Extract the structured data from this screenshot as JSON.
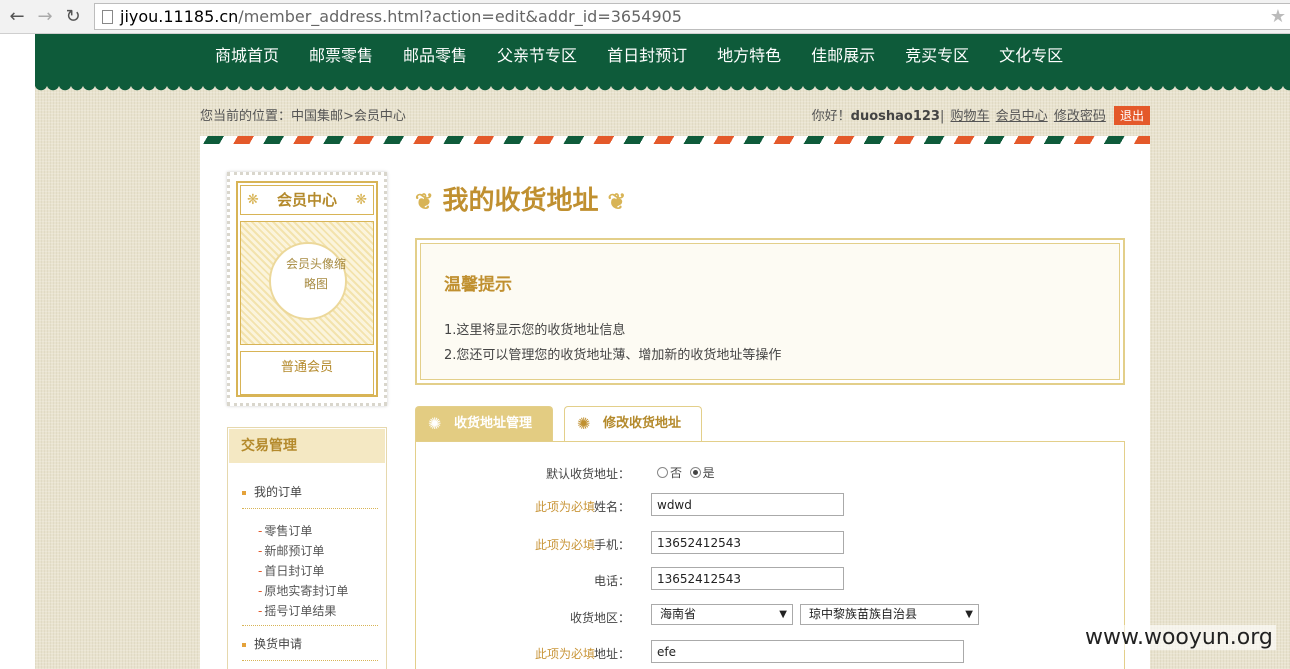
{
  "browser": {
    "url_host": "jiyou.11185.cn",
    "url_path": "/member_address.html?action=edit&addr_id=3654905"
  },
  "nav": [
    "商城首页",
    "邮票零售",
    "邮品零售",
    "父亲节专区",
    "首日封预订",
    "地方特色",
    "佳邮展示",
    "竞买专区",
    "文化专区"
  ],
  "location": "您当前的位置：中国集邮>会员中心",
  "user": {
    "greeting": "你好！",
    "username": "duoshao123",
    "sep": "|",
    "cart": "购物车",
    "member_center": "会员中心",
    "change_pwd": "修改密码",
    "logout": "退出"
  },
  "member_card": {
    "title": "会员中心",
    "photo_alt": "会员头像缩略图",
    "level": "普通会员"
  },
  "menu": {
    "head": "交易管理",
    "my_orders": "我的订单",
    "sub": [
      "零售订单",
      "新邮预订单",
      "首日封订单",
      "原地实寄封订单",
      "摇号订单结果"
    ],
    "exchange": "换货申请"
  },
  "page_title": "我的收货地址",
  "tip": {
    "title": "温馨提示",
    "line1": "1.这里将显示您的收货地址信息",
    "line2": "2.您还可以管理您的收货地址薄、增加新的收货地址等操作"
  },
  "tabs": {
    "manage": "收货地址管理",
    "edit": "修改收货地址"
  },
  "form": {
    "required_text": "此项为必填",
    "default_label": "默认收货地址：",
    "opt_no": "否",
    "opt_yes": "是",
    "name_label": "姓名：",
    "name_value": "wdwd",
    "mobile_label": "手机：",
    "mobile_value": "13652412543",
    "phone_label": "电话：",
    "phone_value": "13652412543",
    "region_label": "收货地区：",
    "province": "海南省",
    "county": "琼中黎族苗族自治县",
    "address_label": "地址：",
    "address_value": "efe"
  },
  "watermark": "www.wooyun.org"
}
